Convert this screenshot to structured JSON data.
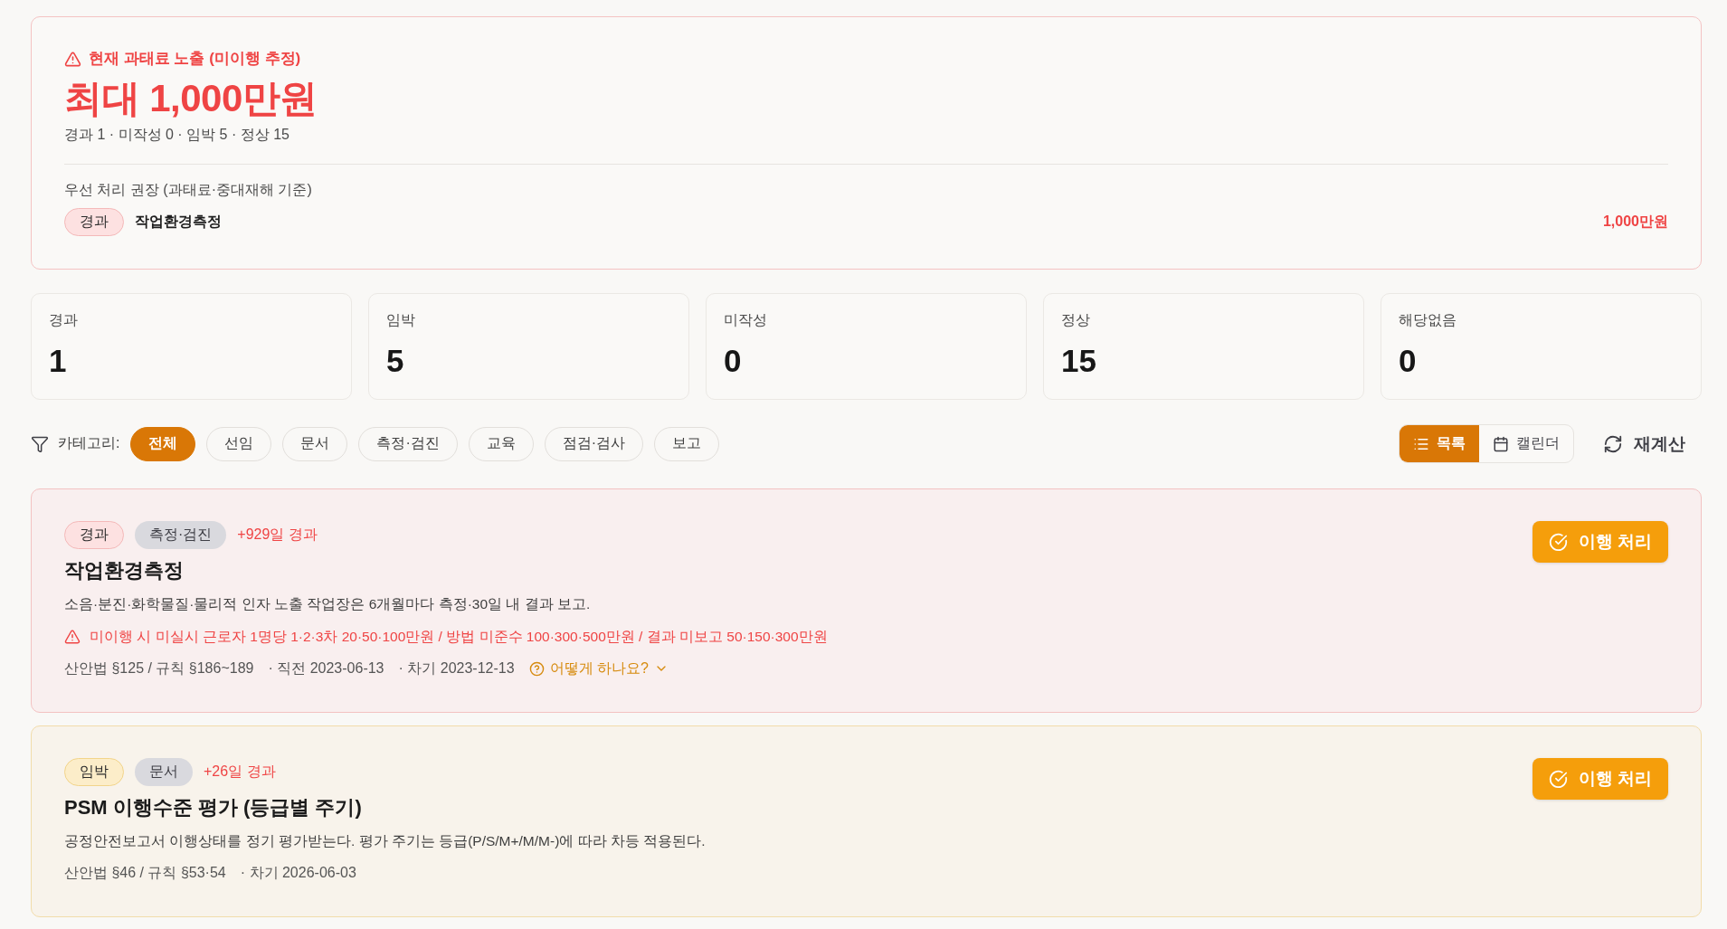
{
  "exposure": {
    "heading": "현재 과태료 노출 (미이행 추정)",
    "amount": "최대 1,000만원",
    "summary": "경과 1 · 미작성 0 · 임박 5 · 정상 15",
    "priority_label": "우선 처리 권장 (과태료·중대재해 기준)",
    "priority_items": [
      {
        "status": {
          "label": "경과",
          "kind": "overdue"
        },
        "name": "작업환경측정",
        "fine": "1,000만원"
      }
    ]
  },
  "stats": [
    {
      "label": "경과",
      "value": "1"
    },
    {
      "label": "임박",
      "value": "5"
    },
    {
      "label": "미작성",
      "value": "0"
    },
    {
      "label": "정상",
      "value": "15"
    },
    {
      "label": "해당없음",
      "value": "0"
    }
  ],
  "filter": {
    "label": "카테고리:",
    "chips": [
      {
        "label": "전체",
        "selected": true
      },
      {
        "label": "선임",
        "selected": false
      },
      {
        "label": "문서",
        "selected": false
      },
      {
        "label": "측정·검진",
        "selected": false
      },
      {
        "label": "교육",
        "selected": false
      },
      {
        "label": "점검·검사",
        "selected": false
      },
      {
        "label": "보고",
        "selected": false
      }
    ]
  },
  "view_toggle": [
    {
      "label": "목록",
      "kind": "list",
      "selected": true
    },
    {
      "label": "캘린더",
      "kind": "calendar",
      "selected": false
    }
  ],
  "recalc_button": "재계산",
  "tasks": [
    {
      "status": {
        "label": "경과",
        "kind": "overdue"
      },
      "category": "측정·검진",
      "elapsed": "+929일 경과",
      "title": "작업환경측정",
      "description": "소음·분진·화학물질·물리적 인자 노출 작업장은 6개월마다 측정·30일 내 결과 보고.",
      "penalty": "미이행 시 미실시 근로자 1명당 1·2·3차 20·50·100만원 / 방법 미준수 100·300·500만원 / 결과 미보고 50·150·300만원",
      "law": "산안법 §125 / 규칙 §186~189",
      "dates": [
        "· 직전 2023-06-13",
        "· 차기 2023-12-13"
      ],
      "help_link": "어떻게 하나요?",
      "action": "이행 처리"
    },
    {
      "status": {
        "label": "임박",
        "kind": "imminent"
      },
      "category": "문서",
      "elapsed": "+26일 경과",
      "title": "PSM 이행수준 평가 (등급별 주기)",
      "description": "공정안전보고서 이행상태를 정기 평가받는다. 평가 주기는 등급(P/S/M+/M/M-)에 따라 차등 적용된다.",
      "law": "산안법 §46 / 규칙 §53·54",
      "dates": [
        "· 차기 2026-06-03"
      ],
      "action": "이행 처리"
    }
  ]
}
